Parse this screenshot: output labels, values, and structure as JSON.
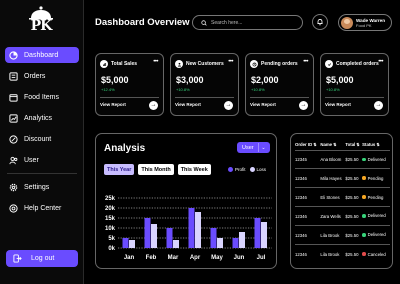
{
  "app": {
    "logo_text": "PK",
    "page_title": "Dashboard Overview"
  },
  "colors": {
    "accent": "#6a4cff",
    "profit": "#6a4cff",
    "loss": "#d9d4ff",
    "positive": "#37d37a",
    "delivered": "#37d37a",
    "pending": "#f5a623",
    "canceled": "#e24b4b"
  },
  "sidebar": {
    "items": [
      {
        "label": "Dashboard",
        "icon": "dashboard-icon",
        "active": true
      },
      {
        "label": "Orders",
        "icon": "orders-icon"
      },
      {
        "label": "Food Items",
        "icon": "food-icon"
      },
      {
        "label": "Analytics",
        "icon": "analytics-icon"
      },
      {
        "label": "Discount",
        "icon": "discount-icon"
      },
      {
        "label": "User",
        "icon": "users-icon"
      }
    ],
    "footer_items": [
      {
        "label": "Settings",
        "icon": "gear-icon"
      },
      {
        "label": "Help Center",
        "icon": "help-icon"
      }
    ],
    "logout_label": "Log out"
  },
  "header": {
    "search_placeholder": "Search here...",
    "user_name": "Wade Warren",
    "user_role": "Food PK"
  },
  "stats": [
    {
      "title": "Total Sales",
      "value": "$5,000",
      "change": "+12.4%",
      "link": "View Report"
    },
    {
      "title": "New Customers",
      "value": "$3,000",
      "change": "+10.8%",
      "link": "View Report"
    },
    {
      "title": "Pending orders",
      "value": "$2,000",
      "change": "+10.8%",
      "link": "View Report"
    },
    {
      "title": "Completed orders",
      "value": "$5,000",
      "change": "+10.8%",
      "link": "View Report"
    }
  ],
  "analysis": {
    "title": "Analysis",
    "select_value": "User",
    "tabs": [
      "This Year",
      "This Month",
      "This Week"
    ],
    "active_tab": 0,
    "legend": [
      "Profit",
      "Loss"
    ]
  },
  "chart_data": {
    "type": "bar",
    "categories": [
      "Jan",
      "Feb",
      "Mar",
      "Apr",
      "May",
      "Jun",
      "Jul"
    ],
    "series": [
      {
        "name": "Profit",
        "values": [
          5,
          15,
          10,
          20,
          10,
          5,
          15
        ]
      },
      {
        "name": "Loss",
        "values": [
          4,
          12,
          4,
          18,
          5,
          8,
          13
        ]
      }
    ],
    "ylim": [
      0,
      25
    ],
    "yticks": [
      "0k",
      "5k",
      "10k",
      "15k",
      "20k",
      "25k"
    ],
    "grid": true,
    "legend_position": "top-right"
  },
  "orders": {
    "columns": [
      "Order ID",
      "Name",
      "Total",
      "Status"
    ],
    "rows": [
      {
        "id": "12345",
        "name": "Ana Bloom",
        "total": "$25.50",
        "status": "Delivered",
        "status_color": "#37d37a"
      },
      {
        "id": "12346",
        "name": "Mila Hayes",
        "total": "$25.50",
        "status": "Pending",
        "status_color": "#f5a623"
      },
      {
        "id": "12346",
        "name": "Eli Stones",
        "total": "$25.50",
        "status": "Pending",
        "status_color": "#f5a623"
      },
      {
        "id": "12346",
        "name": "Zara Wells",
        "total": "$25.50",
        "status": "Delivered",
        "status_color": "#37d37a"
      },
      {
        "id": "12346",
        "name": "Lila Brook",
        "total": "$25.50",
        "status": "Delivered",
        "status_color": "#37d37a"
      },
      {
        "id": "12346",
        "name": "Lila Brook",
        "total": "$25.50",
        "status": "Canceled",
        "status_color": "#e24b4b"
      }
    ]
  }
}
